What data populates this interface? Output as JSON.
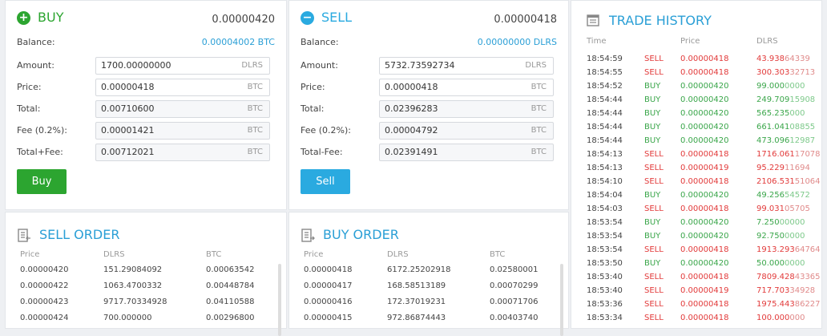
{
  "buy": {
    "title": "BUY",
    "price": "0.00000420",
    "balance_label": "Balance:",
    "balance_value": "0.00004002 BTC",
    "fields": [
      {
        "label": "Amount:",
        "value": "1700.00000000",
        "unit": "DLRS"
      },
      {
        "label": "Price:",
        "value": "0.00000418",
        "unit": "BTC"
      },
      {
        "label": "Total:",
        "value": "0.00710600",
        "unit": "BTC"
      },
      {
        "label": "Fee (0.2%):",
        "value": "0.00001421",
        "unit": "BTC"
      },
      {
        "label": "Total+Fee:",
        "value": "0.00712021",
        "unit": "BTC"
      }
    ],
    "button": "Buy",
    "accent": "#2ca530"
  },
  "sell": {
    "title": "SELL",
    "price": "0.00000418",
    "balance_label": "Balance:",
    "balance_value": "0.00000000 DLRS",
    "fields": [
      {
        "label": "Amount:",
        "value": "5732.73592734",
        "unit": "DLRS"
      },
      {
        "label": "Price:",
        "value": "0.00000418",
        "unit": "BTC"
      },
      {
        "label": "Total:",
        "value": "0.02396283",
        "unit": "BTC"
      },
      {
        "label": "Fee (0.2%):",
        "value": "0.00004792",
        "unit": "BTC"
      },
      {
        "label": "Total-Fee:",
        "value": "0.02391491",
        "unit": "BTC"
      }
    ],
    "button": "Sell",
    "accent": "#2aaae0"
  },
  "sell_order": {
    "title": "SELL ORDER",
    "headers": [
      "Price",
      "DLRS",
      "BTC"
    ],
    "rows": [
      [
        "0.00000420",
        "151.29084092",
        "0.00063542"
      ],
      [
        "0.00000422",
        "1063.4700332",
        "0.00448784"
      ],
      [
        "0.00000423",
        "9717.70334928",
        "0.04110588"
      ],
      [
        "0.00000424",
        "700.000000",
        "0.00296800"
      ]
    ]
  },
  "buy_order": {
    "title": "BUY ORDER",
    "headers": [
      "Price",
      "DLRS",
      "BTC"
    ],
    "rows": [
      [
        "0.00000418",
        "6172.25202918",
        "0.02580001"
      ],
      [
        "0.00000417",
        "168.58513189",
        "0.00070299"
      ],
      [
        "0.00000416",
        "172.37019231",
        "0.00071706"
      ],
      [
        "0.00000415",
        "972.86874443",
        "0.00403740"
      ]
    ]
  },
  "trade_history": {
    "title": "TRADE HISTORY",
    "headers": [
      "Time",
      "Price",
      "DLRS"
    ],
    "rows": [
      {
        "time": "18:54:59",
        "type": "SELL",
        "price": "0.00000418",
        "amt": "43.938",
        "amt_tail": "64339"
      },
      {
        "time": "18:54:55",
        "type": "SELL",
        "price": "0.00000418",
        "amt": "300.303",
        "amt_tail": "32713"
      },
      {
        "time": "18:54:52",
        "type": "BUY",
        "price": "0.00000420",
        "amt": "99.000",
        "amt_tail": "0000"
      },
      {
        "time": "18:54:44",
        "type": "BUY",
        "price": "0.00000420",
        "amt": "249.709",
        "amt_tail": "15908"
      },
      {
        "time": "18:54:44",
        "type": "BUY",
        "price": "0.00000420",
        "amt": "565.235",
        "amt_tail": "000"
      },
      {
        "time": "18:54:44",
        "type": "BUY",
        "price": "0.00000420",
        "amt": "661.041",
        "amt_tail": "08855"
      },
      {
        "time": "18:54:44",
        "type": "BUY",
        "price": "0.00000420",
        "amt": "473.096",
        "amt_tail": "12987"
      },
      {
        "time": "18:54:13",
        "type": "SELL",
        "price": "0.00000418",
        "amt": "1716.061",
        "amt_tail": "17078"
      },
      {
        "time": "18:54:13",
        "type": "SELL",
        "price": "0.00000419",
        "amt": "95.229",
        "amt_tail": "11694"
      },
      {
        "time": "18:54:10",
        "type": "SELL",
        "price": "0.00000418",
        "amt": "2106.531",
        "amt_tail": "51064"
      },
      {
        "time": "18:54:04",
        "type": "BUY",
        "price": "0.00000420",
        "amt": "49.256",
        "amt_tail": "54572"
      },
      {
        "time": "18:54:03",
        "type": "SELL",
        "price": "0.00000418",
        "amt": "99.031",
        "amt_tail": "05705"
      },
      {
        "time": "18:53:54",
        "type": "BUY",
        "price": "0.00000420",
        "amt": "7.250",
        "amt_tail": "00000"
      },
      {
        "time": "18:53:54",
        "type": "BUY",
        "price": "0.00000420",
        "amt": "92.750",
        "amt_tail": "0000"
      },
      {
        "time": "18:53:54",
        "type": "SELL",
        "price": "0.00000418",
        "amt": "1913.293",
        "amt_tail": "64764"
      },
      {
        "time": "18:53:50",
        "type": "BUY",
        "price": "0.00000420",
        "amt": "50.000",
        "amt_tail": "0000"
      },
      {
        "time": "18:53:40",
        "type": "SELL",
        "price": "0.00000418",
        "amt": "7809.428",
        "amt_tail": "43365"
      },
      {
        "time": "18:53:40",
        "type": "SELL",
        "price": "0.00000419",
        "amt": "717.703",
        "amt_tail": "34928"
      },
      {
        "time": "18:53:36",
        "type": "SELL",
        "price": "0.00000418",
        "amt": "1975.443",
        "amt_tail": "86227"
      },
      {
        "time": "18:53:34",
        "type": "SELL",
        "price": "0.00000418",
        "amt": "100.000",
        "amt_tail": "000"
      }
    ]
  }
}
